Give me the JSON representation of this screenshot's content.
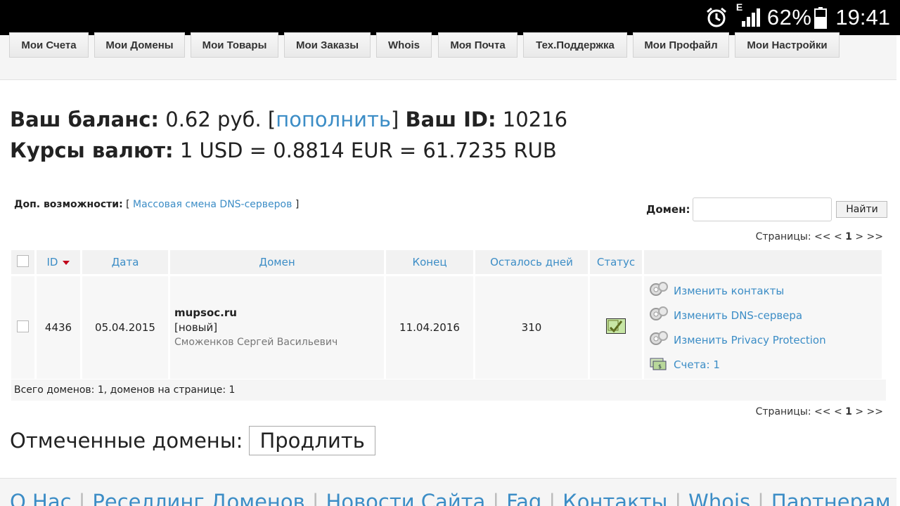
{
  "status_bar": {
    "network": "E",
    "battery": "62%",
    "time": "19:41"
  },
  "nav": [
    "Мои Счета",
    "Мои Домены",
    "Мои Товары",
    "Мои Заказы",
    "Whois",
    "Моя Почта",
    "Тех.Поддержка",
    "Мои Профайл",
    "Мои Настройки"
  ],
  "balance": {
    "label": "Ваш баланс:",
    "amount": "0.62 руб.",
    "topup_link": "пополнить",
    "id_label": "Ваш ID:",
    "id_value": "10216",
    "rates_label": "Курсы валют:",
    "rates_value": "1 USD = 0.8814 EUR = 61.7235 RUB"
  },
  "extras": {
    "label": "Доп. возможности:",
    "link": "Массовая смена DNS-серверов"
  },
  "search": {
    "label": "Домен:",
    "placeholder": "",
    "button": "Найти"
  },
  "pager": {
    "label": "Страницы:",
    "first": "<<",
    "prev": "<",
    "current": "1",
    "next": ">",
    "last": ">>"
  },
  "table": {
    "headers": [
      "ID",
      "Дата",
      "Домен",
      "Конец",
      "Осталось дней",
      "Статус"
    ],
    "rows": [
      {
        "id": "4436",
        "date": "05.04.2015",
        "domain": "mupsoc.ru",
        "tag": "[новый]",
        "owner": "Сможенков Сергей Васильевич",
        "end": "11.04.2016",
        "days_left": "310",
        "status_icon": "edit-icon",
        "actions": [
          "Изменить контакты",
          "Изменить DNS-сервера",
          "Изменить Privacy Protection",
          "Счета: 1"
        ]
      }
    ]
  },
  "summary": "Всего доменов: 1, доменов на странице: 1",
  "marked": {
    "label": "Отмеченные домены:",
    "button": "Продлить"
  },
  "footer": [
    "О Нас",
    "Реселлинг Доменов",
    "Новости Сайта",
    "Faq",
    "Контакты",
    "Whois",
    "Партнерам"
  ]
}
